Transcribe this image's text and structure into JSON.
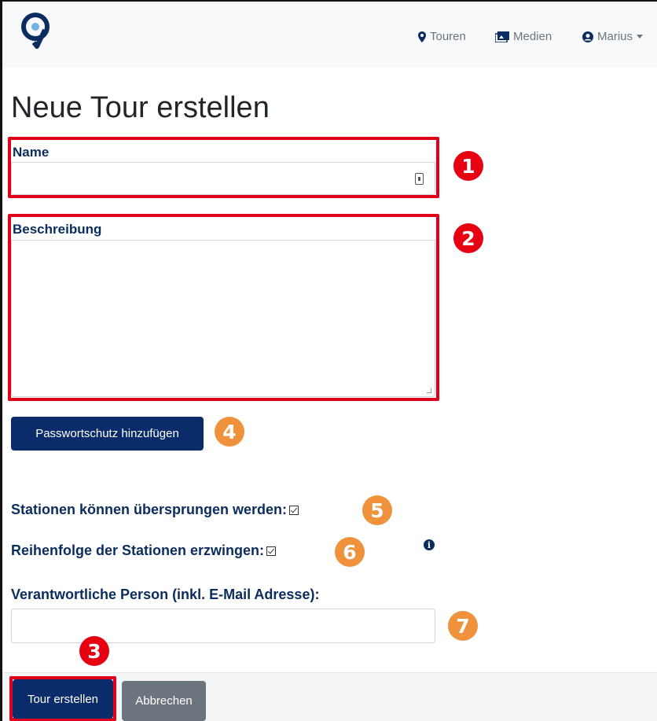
{
  "navbar": {
    "logo_icon": "tour-logo-icon",
    "touren_label": "Touren",
    "medien_label": "Medien",
    "user_label": "Marius"
  },
  "page": {
    "title": "Neue Tour erstellen"
  },
  "form": {
    "name_label": "Name",
    "name_value": "",
    "beschreibung_label": "Beschreibung",
    "beschreibung_value": "",
    "password_button": "Passwortschutz hinzufügen",
    "skip_stations_label": "Stationen können übersprungen werden:",
    "skip_stations_checked": true,
    "enforce_order_label": "Reihenfolge der Stationen erzwingen:",
    "enforce_order_checked": true,
    "responsible_label": "Verantwortliche Person (inkl. E-Mail Adresse):",
    "responsible_value": ""
  },
  "footer": {
    "create_button": "Tour erstellen",
    "cancel_button": "Abbrechen"
  },
  "callouts": {
    "c1": "1",
    "c2": "2",
    "c3": "3",
    "c4": "4",
    "c5": "5",
    "c6": "6",
    "c7": "7"
  },
  "colors": {
    "primary": "#0b2c6a",
    "label": "#0b2c5e",
    "highlight_red": "#e0001b",
    "badge_orange": "#f0913b",
    "secondary": "#6c757d"
  }
}
